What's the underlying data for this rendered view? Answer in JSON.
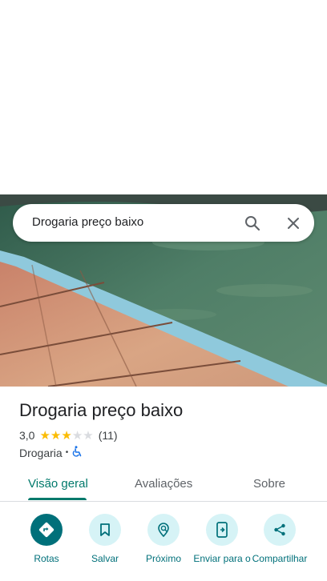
{
  "search": {
    "query": "Drogaria preço baixo"
  },
  "place": {
    "title": "Drogaria preço baixo",
    "rating_text": "3,0",
    "rating_value": 3,
    "rating_max": 5,
    "review_count": "(11)",
    "category": "Drogaria",
    "separator": "•"
  },
  "tabs": [
    {
      "label": "Visão geral",
      "active": true
    },
    {
      "label": "Avaliações",
      "active": false
    },
    {
      "label": "Sobre",
      "active": false
    }
  ],
  "actions": [
    {
      "label": "Rotas",
      "icon": "directions-icon"
    },
    {
      "label": "Salvar",
      "icon": "bookmark-icon"
    },
    {
      "label": "Próximo",
      "icon": "nearby-icon"
    },
    {
      "label": "Enviar para o",
      "icon": "send-to-phone-icon"
    },
    {
      "label": "Compartilhar",
      "icon": "share-icon"
    }
  ],
  "colors": {
    "accent": "#00796b",
    "action_bg": "#d6f3f6",
    "star_filled": "#fbbc04",
    "star_empty": "#dadce0"
  }
}
